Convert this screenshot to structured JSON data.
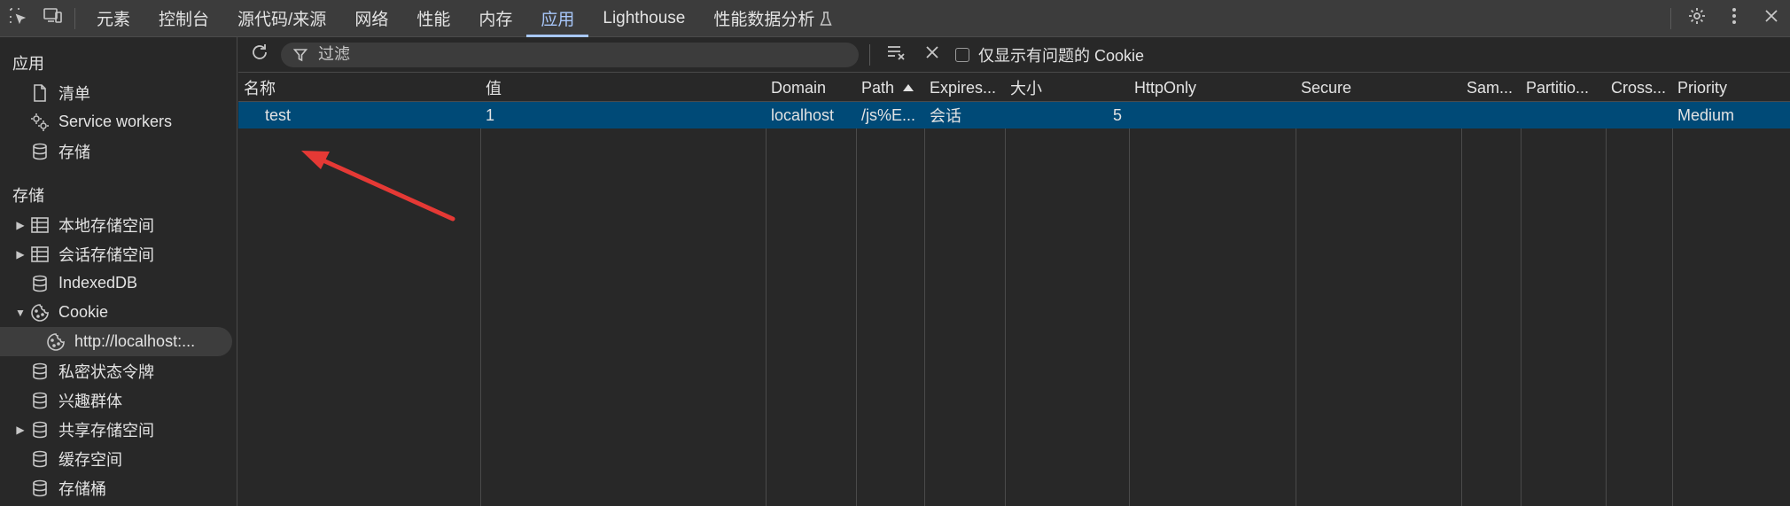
{
  "top_tabs": [
    "元素",
    "控制台",
    "源代码/来源",
    "网络",
    "性能",
    "内存",
    "应用",
    "Lighthouse",
    "性能数据分析"
  ],
  "active_tab": "应用",
  "sidebar": {
    "app_section_title": "应用",
    "app_items": [
      {
        "label": "清单",
        "icon": "document-icon"
      },
      {
        "label": "Service workers",
        "icon": "gears-icon"
      },
      {
        "label": "存储",
        "icon": "database-icon"
      }
    ],
    "storage_section_title": "存储",
    "storage_items": [
      {
        "label": "本地存储空间",
        "icon": "table-icon",
        "expandable": true
      },
      {
        "label": "会话存储空间",
        "icon": "table-icon",
        "expandable": true
      },
      {
        "label": "IndexedDB",
        "icon": "database-icon"
      },
      {
        "label": "Cookie",
        "icon": "cookie-icon",
        "expanded": true
      },
      {
        "label": "http://localhost:...",
        "icon": "cookie-icon",
        "child": true,
        "selected": true
      },
      {
        "label": "私密状态令牌",
        "icon": "database-icon"
      },
      {
        "label": "兴趣群体",
        "icon": "database-icon"
      },
      {
        "label": "共享存储空间",
        "icon": "database-icon",
        "expandable": true
      },
      {
        "label": "缓存空间",
        "icon": "database-icon"
      },
      {
        "label": "存储桶",
        "icon": "database-icon"
      }
    ]
  },
  "toolbar": {
    "filter_placeholder": "过滤",
    "only_issues_label": "仅显示有问题的 Cookie"
  },
  "table": {
    "columns": [
      "名称",
      "值",
      "Domain",
      "Path",
      "Expires...",
      "大小",
      "HttpOnly",
      "Secure",
      "Sam...",
      "Partitio...",
      "Cross...",
      "Priority"
    ],
    "sorted_column": "Path",
    "rows": [
      {
        "name": "test",
        "value": "1",
        "domain": "localhost",
        "path": "/js%E...",
        "expires": "会话",
        "size": "5",
        "httponly": "",
        "secure": "",
        "samesite": "",
        "partition": "",
        "cross": "",
        "priority": "Medium"
      }
    ]
  },
  "colors": {
    "selected_row": "#004a77",
    "active_tab": "#a8c7fa",
    "annotation_arrow": "#e53935"
  }
}
